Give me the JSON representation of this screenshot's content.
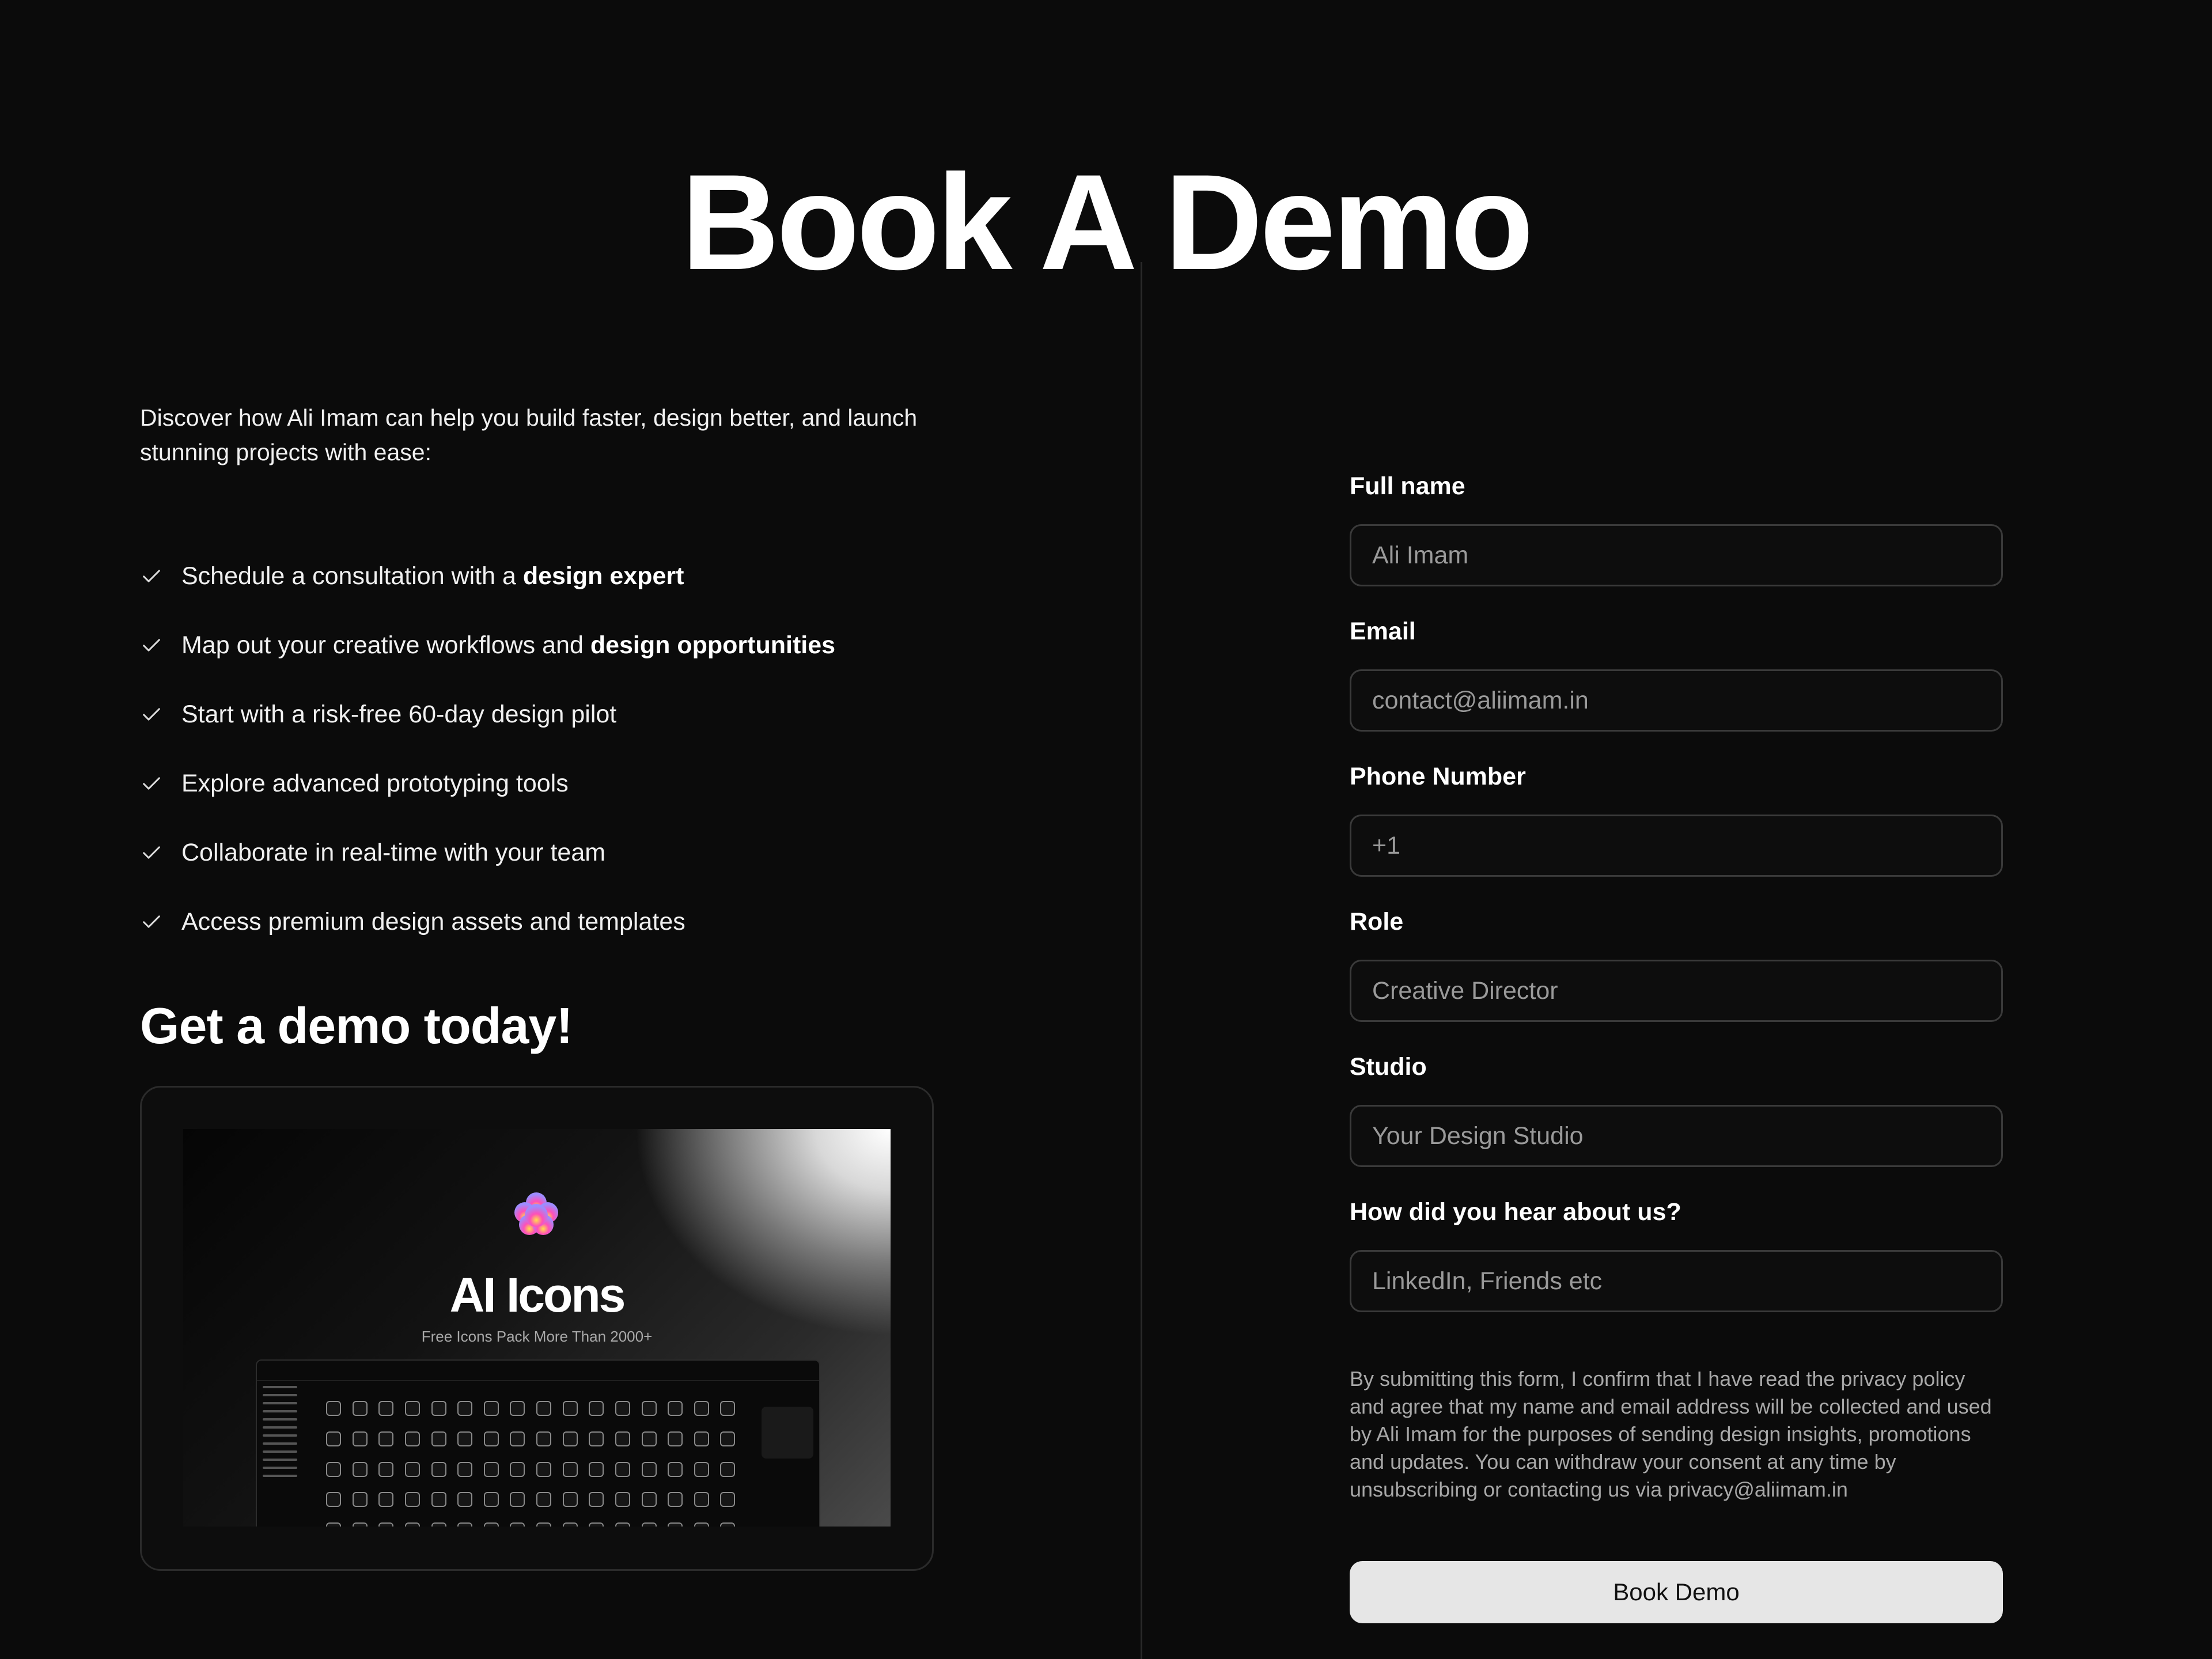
{
  "page": {
    "title": "Book A Demo"
  },
  "intro": {
    "text": "Discover how Ali Imam can help you build faster, design better, and launch stunning projects with ease:"
  },
  "features": [
    {
      "text": "Schedule a consultation with a ",
      "bold": "design expert",
      "icon": "check-icon"
    },
    {
      "text": "Map out your creative workflows and ",
      "bold": "design opportunities",
      "icon": "check-icon"
    },
    {
      "text": "Start with a risk-free 60-day design pilot",
      "bold": "",
      "icon": "check-icon"
    },
    {
      "text": "Explore advanced prototyping tools",
      "bold": "",
      "icon": "check-icon"
    },
    {
      "text": "Collaborate in real-time with your team",
      "bold": "",
      "icon": "check-icon"
    },
    {
      "text": "Access premium design assets and templates",
      "bold": "",
      "icon": "check-icon"
    }
  ],
  "demo": {
    "heading": "Get a demo today!",
    "preview": {
      "title": "AI Icons",
      "subtitle": "Free Icons Pack More Than 2000+"
    }
  },
  "form": {
    "fields": [
      {
        "label": "Full name",
        "placeholder": "Ali Imam"
      },
      {
        "label": "Email",
        "placeholder": "contact@aliimam.in"
      },
      {
        "label": "Phone Number",
        "placeholder": "+1"
      },
      {
        "label": "Role",
        "placeholder": "Creative Director"
      },
      {
        "label": "Studio",
        "placeholder": "Your Design Studio"
      },
      {
        "label": "How did you hear about us?",
        "placeholder": "LinkedIn, Friends etc"
      }
    ],
    "consent": "By submitting this form, I confirm that I have read the privacy policy and agree that my name and email address will be collected and used by Ali Imam for the purposes of sending design insights, promotions and updates. You can withdraw your consent at any time by unsubscribing or contacting us via privacy@aliimam.in",
    "submit_label": "Book Demo"
  },
  "colors": {
    "background": "#0b0b0b",
    "text": "#ffffff",
    "muted": "#a8a8a8",
    "button": "#e6e6e6"
  }
}
